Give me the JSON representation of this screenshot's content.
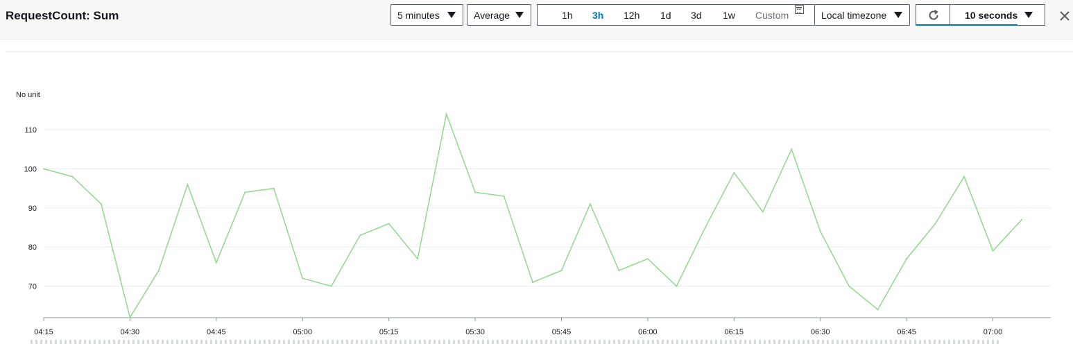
{
  "header": {
    "title": "RequestCount: Sum",
    "period": "5 minutes",
    "statistic": "Average",
    "ranges": [
      "1h",
      "3h",
      "12h",
      "1d",
      "3d",
      "1w"
    ],
    "active_range": "3h",
    "custom_label": "Custom",
    "timezone": "Local timezone",
    "refresh_interval": "10 seconds",
    "accent_color": "#0073bb"
  },
  "chart_data": {
    "type": "line",
    "unit_label": "No unit",
    "x": [
      "04:15",
      "04:20",
      "04:25",
      "04:30",
      "04:35",
      "04:40",
      "04:45",
      "04:50",
      "04:55",
      "05:00",
      "05:05",
      "05:10",
      "05:15",
      "05:20",
      "05:25",
      "05:30",
      "05:35",
      "05:40",
      "05:45",
      "05:50",
      "05:55",
      "06:00",
      "06:05",
      "06:10",
      "06:15",
      "06:20",
      "06:25",
      "06:30",
      "06:35",
      "06:40",
      "06:45",
      "06:50",
      "06:55",
      "07:00",
      "07:05"
    ],
    "series": [
      {
        "color": "#8fd98b",
        "values": [
          100,
          98,
          91,
          62,
          74,
          96,
          76,
          94,
          95,
          72,
          70,
          83,
          86,
          77,
          114,
          94,
          93,
          71,
          74,
          91,
          74,
          77,
          70,
          85,
          99,
          89,
          105,
          84,
          70,
          64,
          77,
          86,
          98,
          79,
          87
        ]
      }
    ],
    "x_ticks": [
      "04:15",
      "04:30",
      "04:45",
      "05:00",
      "05:15",
      "05:30",
      "05:45",
      "06:00",
      "06:15",
      "06:30",
      "06:45",
      "07:00"
    ],
    "y_ticks": [
      70,
      80,
      90,
      100,
      110
    ],
    "ylim": [
      62,
      116
    ],
    "grid": true
  }
}
